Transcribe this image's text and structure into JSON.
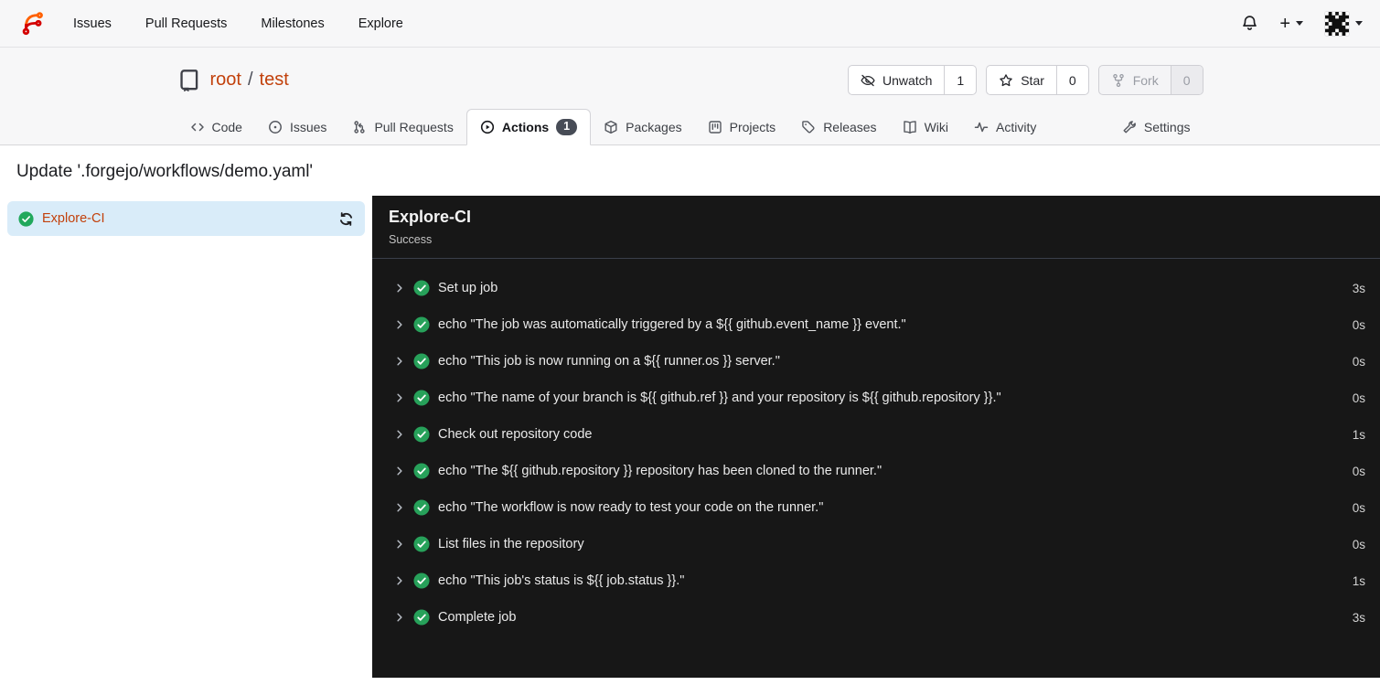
{
  "navbar": {
    "logo_icon": "forgejo-logo",
    "items": [
      {
        "label": "Issues"
      },
      {
        "label": "Pull Requests"
      },
      {
        "label": "Milestones"
      },
      {
        "label": "Explore"
      }
    ],
    "bell_icon": "bell-icon",
    "plus_label": "+",
    "avatar_icon": "user-identicon"
  },
  "repo_header": {
    "repo_icon": "repo-book-icon",
    "owner": "root",
    "separator": "/",
    "name": "test",
    "buttons": [
      {
        "label": "Unwatch",
        "count": "1",
        "icon": "eye-slash-icon"
      },
      {
        "label": "Star",
        "count": "0",
        "icon": "star-icon"
      },
      {
        "label": "Fork",
        "count": "0",
        "icon": "git-fork-icon",
        "disabled": true
      }
    ],
    "tabs": [
      {
        "label": "Code",
        "icon": "code-icon"
      },
      {
        "label": "Issues",
        "icon": "issue-opened-icon"
      },
      {
        "label": "Pull Requests",
        "icon": "git-pull-request-icon"
      },
      {
        "label": "Actions",
        "icon": "play-circle-icon",
        "badge": "1",
        "active": true
      },
      {
        "label": "Packages",
        "icon": "package-icon"
      },
      {
        "label": "Projects",
        "icon": "project-board-icon"
      },
      {
        "label": "Releases",
        "icon": "tag-icon"
      },
      {
        "label": "Wiki",
        "icon": "book-open-icon"
      },
      {
        "label": "Activity",
        "icon": "pulse-icon"
      }
    ],
    "settings_tab": {
      "label": "Settings",
      "icon": "wrench-icon"
    }
  },
  "run": {
    "title": "Update '.forgejo/workflows/demo.yaml'",
    "sidebar": {
      "job": {
        "name": "Explore-CI",
        "status": "success",
        "status_icon": "check-circle-icon",
        "refresh_icon": "sync-icon"
      }
    },
    "panel": {
      "job_name": "Explore-CI",
      "status_text": "Success",
      "steps": [
        {
          "name": "Set up job",
          "duration": "3s",
          "status": "success"
        },
        {
          "name": "echo \"The job was automatically triggered by a ${{ github.event_name }} event.\"",
          "duration": "0s",
          "status": "success"
        },
        {
          "name": "echo \"This job is now running on a ${{ runner.os }} server.\"",
          "duration": "0s",
          "status": "success"
        },
        {
          "name": "echo \"The name of your branch is ${{ github.ref }} and your repository is ${{ github.repository }}.\"",
          "duration": "0s",
          "status": "success"
        },
        {
          "name": "Check out repository code",
          "duration": "1s",
          "status": "success"
        },
        {
          "name": "echo \"The ${{ github.repository }} repository has been cloned to the runner.\"",
          "duration": "0s",
          "status": "success"
        },
        {
          "name": "echo \"The workflow is now ready to test your code on the runner.\"",
          "duration": "0s",
          "status": "success"
        },
        {
          "name": "List files in the repository",
          "duration": "0s",
          "status": "success"
        },
        {
          "name": "echo \"This job's status is ${{ job.status }}.\"",
          "duration": "1s",
          "status": "success"
        },
        {
          "name": "Complete job",
          "duration": "3s",
          "status": "success"
        }
      ]
    }
  },
  "colors": {
    "accent_link": "#c2410c",
    "success_green": "#21a85c",
    "log_background": "#171717",
    "active_job_background": "#d9ecf9",
    "badge_background": "#474c56",
    "header_background": "#f7f7f8"
  }
}
